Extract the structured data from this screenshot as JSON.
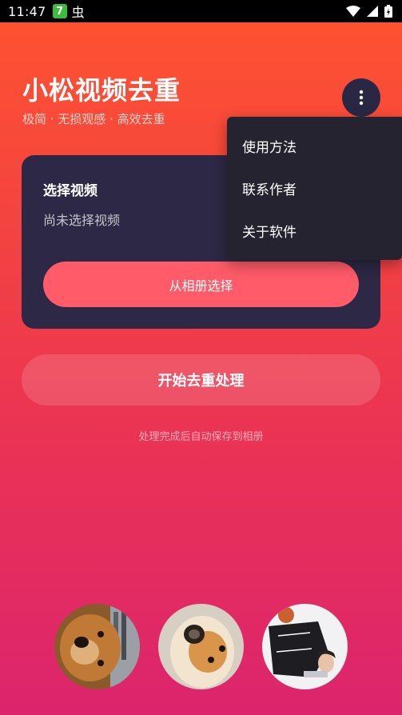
{
  "status_bar": {
    "time": "11:47",
    "badge": "7",
    "app_icon": "虫"
  },
  "header": {
    "title": "小松视频去重",
    "subtitle": "极简 · 无损观感 · 高效去重",
    "menu_icon": "more-vert-icon"
  },
  "select_card": {
    "title": "选择视频",
    "status": "尚未选择视频",
    "album_button": "从相册选择"
  },
  "start_button": "开始去重处理",
  "hint": "处理完成后自动保存到相册",
  "menu": {
    "items": [
      "使用方法",
      "联系作者",
      "关于软件"
    ]
  },
  "colors": {
    "bg_top": "#ff5330",
    "bg_bottom": "#dc246e",
    "card": "#2c2845",
    "accent_button": "#ff5b68",
    "menu_bg": "#25232f"
  },
  "avatars": [
    "dog-photo-1",
    "dog-photo-2",
    "person-photo"
  ]
}
